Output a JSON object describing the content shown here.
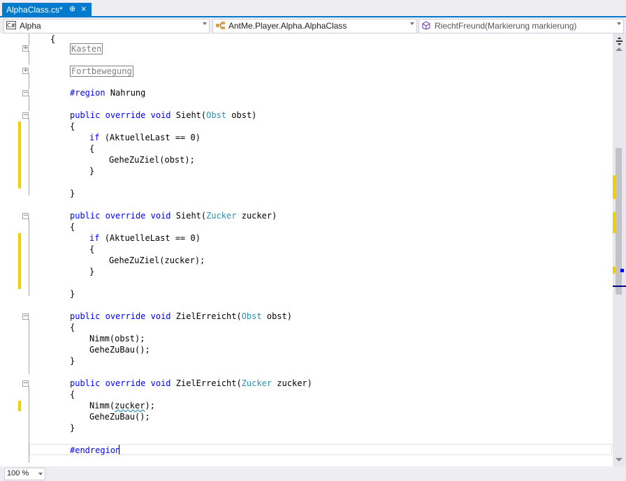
{
  "tab": {
    "title": "AlphaClass.cs*",
    "pin": "⊕",
    "close": "×"
  },
  "nav": {
    "project": "Alpha",
    "project_icon": "C#",
    "class": "AntMe.Player.Alpha.AlphaClass",
    "member": "RiechtFreund(Markierung markierung)"
  },
  "code": {
    "brace_open": "{",
    "region_kasten": "Kasten",
    "region_fortbewegung": "Fortbewegung",
    "region_start": "#region",
    "region_nahrung": "Nahrung",
    "kw_public": "public",
    "kw_override": "override",
    "kw_void": "void",
    "kw_if": "if",
    "m_sieht": "Sieht",
    "m_zielerreicht": "ZielErreicht",
    "t_obst": "Obst",
    "t_zucker": "Zucker",
    "p_obst": "obst)",
    "p_zucker": "zucker)",
    "paren": "(",
    "cond": "(AktuelleLast == 0)",
    "call_gehe_obst": "GeheZuZiel(obst);",
    "call_gehe_zucker": "GeheZuZiel(zucker);",
    "call_nimm_obst": "Nimm(obst);",
    "call_nimm_pre": "Nimm(",
    "call_nimm_arg": "zucker",
    "call_nimm_post": ");",
    "call_bau": "GeheZuBau();",
    "brace_close": "}",
    "region_end": "#endregion"
  },
  "zoom": {
    "value": "100 %"
  },
  "colors": {
    "accent": "#007acc",
    "keyword": "#0000ff",
    "type": "#2b91af",
    "change_marker": "#efd100"
  }
}
